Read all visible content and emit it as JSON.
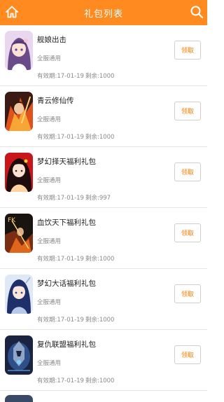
{
  "header": {
    "title": "礼包列表",
    "brand_color": "#ff8a1f"
  },
  "gifts": [
    {
      "name": "舰娘出击",
      "scope": "全服通用",
      "expiry": "有效期:17-01-19",
      "remaining": "剩余:1000",
      "button_label": "领取",
      "icon": "game-cover-anime-girl"
    },
    {
      "name": "青云修仙传",
      "scope": "全服通用",
      "expiry": "有效期:17-01-19",
      "remaining": "剩余:1000",
      "button_label": "领取",
      "icon": "game-cover-fire-warrior"
    },
    {
      "name": "梦幻择天福利礼包",
      "scope": "全服通用",
      "expiry": "有效期:17-01-19",
      "remaining": "剩余:997",
      "button_label": "领取",
      "icon": "game-cover-red-hair-heroine"
    },
    {
      "name": "血饮天下福利礼包",
      "scope": "全服通用",
      "expiry": "有效期:17-01-19",
      "remaining": "剩余:1000",
      "button_label": "领取",
      "icon": "game-cover-fk-warrior"
    },
    {
      "name": "梦幻大话福利礼包",
      "scope": "全服通用",
      "expiry": "有效期:17-01-19",
      "remaining": "剩余:1000",
      "button_label": "领取",
      "icon": "game-cover-blue-hair-swordswoman"
    },
    {
      "name": "复仇联盟福利礼包",
      "scope": "全服通用",
      "expiry": "有效期:17-01-19",
      "remaining": "剩余:1000",
      "button_label": "领取",
      "icon": "game-cover-armored-knight"
    }
  ]
}
